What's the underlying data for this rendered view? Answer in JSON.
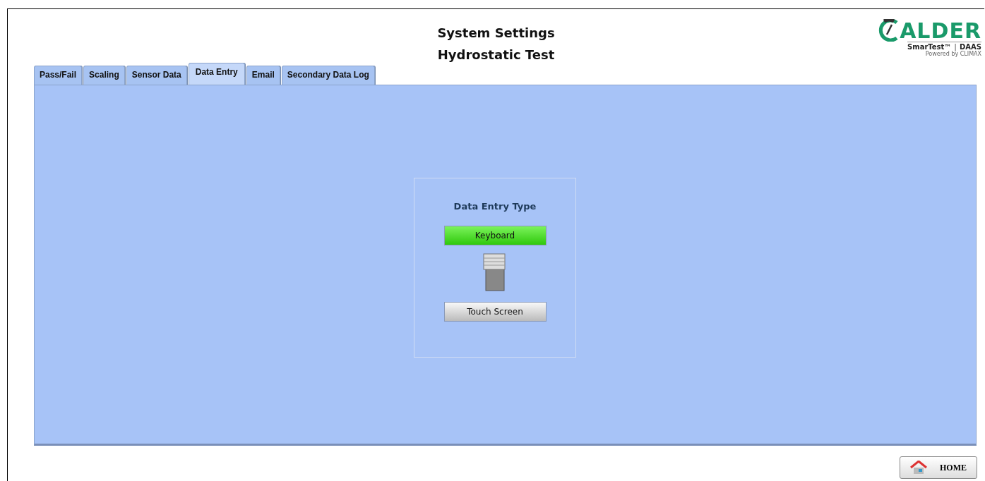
{
  "header": {
    "title": "System Settings",
    "subtitle": "Hydrostatic Test"
  },
  "logo": {
    "wordmark": "ALDER",
    "product": "SmarTest™",
    "divider": "|",
    "suffix": "DAAS",
    "powered": "Powered by CLIMAX"
  },
  "tabs": [
    {
      "label": "Pass/Fail",
      "selected": false
    },
    {
      "label": "Scaling",
      "selected": false
    },
    {
      "label": "Sensor Data",
      "selected": false
    },
    {
      "label": "Data Entry",
      "selected": true
    },
    {
      "label": "Email",
      "selected": false
    },
    {
      "label": "Secondary Data Log",
      "selected": false
    }
  ],
  "data_entry": {
    "title": "Data Entry Type",
    "options": [
      {
        "label": "Keyboard",
        "selected": true
      },
      {
        "label": "Touch Screen",
        "selected": false
      }
    ]
  },
  "home_button": {
    "label": "HOME"
  }
}
